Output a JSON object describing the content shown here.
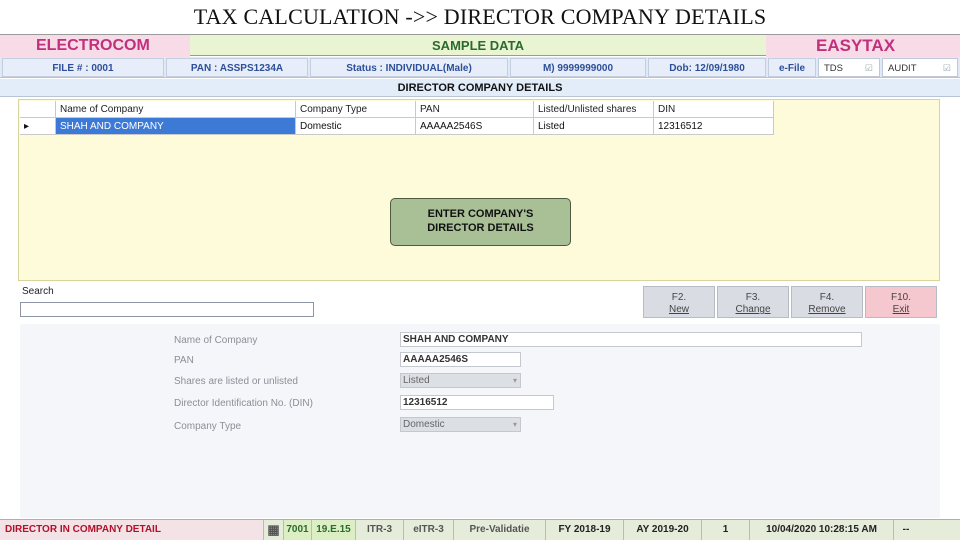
{
  "slide_title": "TAX CALCULATION ->> DIRECTOR COMPANY DETAILS",
  "brand": {
    "left": "ELECTROCOM",
    "center": "SAMPLE DATA",
    "right": "EASYTAX"
  },
  "info": {
    "file": "FILE # : 0001",
    "pan": "PAN : ASSPS1234A",
    "status": "Status : INDIVIDUAL(Male)",
    "mobile": "M) 9999999000",
    "dob": "Dob: 12/09/1980",
    "efile": "e-File",
    "tds": "TDS",
    "audit": "AUDIT"
  },
  "section_title": "DIRECTOR COMPANY DETAILS",
  "grid": {
    "headers": [
      "Name of Company",
      "Company Type",
      "PAN",
      "Listed/Unlisted shares",
      "DIN"
    ],
    "rows": [
      {
        "marker": "▸",
        "name": "SHAH AND COMPANY",
        "type": "Domestic",
        "pan": "AAAAA2546S",
        "listed": "Listed",
        "din": "12316512"
      }
    ]
  },
  "message_line1": "ENTER COMPANY'S",
  "message_line2": "DIRECTOR DETAILS",
  "search_label": "Search",
  "buttons": {
    "new_key": "F2.",
    "new_label": "New",
    "change_key": "F3.",
    "change_label": "Change",
    "remove_key": "F4.",
    "remove_label": "Remove",
    "exit_key": "F10.",
    "exit_label": "Exit"
  },
  "form": {
    "name_label": "Name of Company",
    "name_value": "SHAH AND COMPANY",
    "pan_label": "PAN",
    "pan_value": "AAAAA2546S",
    "listed_label": "Shares are listed or unlisted",
    "listed_value": "Listed",
    "din_label": "Director Identification No. (DIN)",
    "din_value": "12316512",
    "type_label": "Company Type",
    "type_value": "Domestic"
  },
  "statusbar": {
    "screen": "DIRECTOR IN COMPANY DETAIL",
    "code": "7001",
    "version": "19.E.15",
    "itr": "ITR-3",
    "eitr": "eITR-3",
    "prevalidate": "Pre-Validatie",
    "fy": "FY 2018-19",
    "ay": "AY 2019-20",
    "count": "1",
    "datetime": "10/04/2020 10:28:15 AM",
    "end": "--"
  },
  "colors": {
    "brand_pink": "#c0307e",
    "selection_blue": "#3d7ad6",
    "panel_yellow": "#fdfbd9",
    "exit_pink": "#f5c7cf",
    "message_green": "#a9bf96"
  }
}
